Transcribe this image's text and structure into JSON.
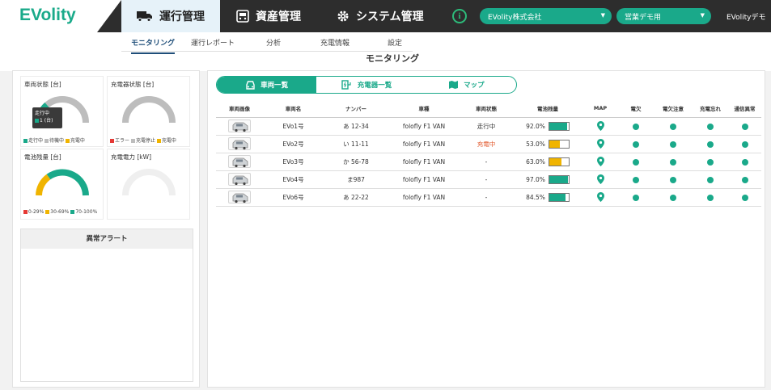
{
  "app": {
    "logo": "EVolity"
  },
  "topnav": {
    "tabs": [
      {
        "label": "運行管理",
        "icon": "truck-icon",
        "active": true
      },
      {
        "label": "資産管理",
        "icon": "asset-icon",
        "active": false
      },
      {
        "label": "システム管理",
        "icon": "gear-icon",
        "active": false
      }
    ],
    "company_select": "EVolity株式会社",
    "dept_select": "営業デモ用",
    "user": "EVolityデモ"
  },
  "subnav": {
    "tabs": [
      "モニタリング",
      "運行レポート",
      "分析",
      "充電情報",
      "設定"
    ],
    "active": "モニタリング"
  },
  "page_title": "モニタリング",
  "left": {
    "vehicle_status": {
      "title": "車両状態 [台]",
      "tooltip_title": "走行中",
      "tooltip_value": "1 (台)",
      "legend": [
        "走行中",
        "待機中",
        "充電中"
      ]
    },
    "charger_status": {
      "title": "充電器状態 [台]",
      "legend": [
        "エラー",
        "充電停止",
        "充電中"
      ]
    },
    "battery_level": {
      "title": "電池残量 [台]",
      "legend": [
        "0-29%",
        "30-69%",
        "70-100%"
      ]
    },
    "charge_power": {
      "title": "充電電力 [kW]"
    },
    "alert": {
      "title": "異常アラート"
    }
  },
  "main": {
    "tabs": [
      {
        "label": "車両一覧",
        "icon": "car-icon",
        "active": true
      },
      {
        "label": "充電器一覧",
        "icon": "charger-icon",
        "active": false
      },
      {
        "label": "マップ",
        "icon": "map-icon",
        "active": false
      }
    ],
    "columns": [
      "車両画像",
      "車両名",
      "ナンバー",
      "車種",
      "車両状態",
      "電池残量",
      "MAP",
      "電欠",
      "電欠注意",
      "充電忘れ",
      "通信異常"
    ],
    "rows": [
      {
        "name": "EVo1号",
        "plate": "あ 12-34",
        "model": "folofly F1 VAN",
        "status": "走行中",
        "battery": "92.0%",
        "battery_value": 92.0,
        "battery_color": "#1aa98a"
      },
      {
        "name": "EVo2号",
        "plate": "い 11-11",
        "model": "folofly F1 VAN",
        "status": "充電中",
        "battery": "53.0%",
        "battery_value": 53.0,
        "battery_color": "#f0b400"
      },
      {
        "name": "EVo3号",
        "plate": "か 56-78",
        "model": "folofly F1 VAN",
        "status": "-",
        "battery": "63.0%",
        "battery_value": 63.0,
        "battery_color": "#f0b400"
      },
      {
        "name": "EVo4号",
        "plate": "ま987",
        "model": "folofly F1 VAN",
        "status": "-",
        "battery": "97.0%",
        "battery_value": 97.0,
        "battery_color": "#1aa98a"
      },
      {
        "name": "EVo6号",
        "plate": "あ 22-22",
        "model": "folofly F1 VAN",
        "status": "-",
        "battery": "84.5%",
        "battery_value": 84.5,
        "battery_color": "#1aa98a"
      }
    ]
  },
  "colors": {
    "accent": "#1aa98a",
    "warn": "#e2572b",
    "yellow": "#f0b400",
    "red": "#e53935",
    "gray": "#bdbdbd"
  }
}
